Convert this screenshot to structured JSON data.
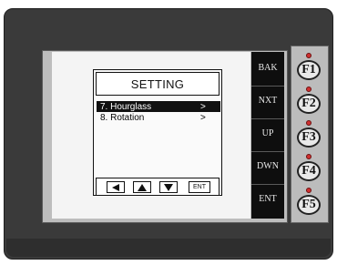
{
  "screen": {
    "title": "SETTING",
    "items": [
      {
        "label": "7. Hourglass",
        "arrow": ">"
      },
      {
        "label": "8. Rotation",
        "arrow": ">"
      }
    ],
    "nav_buttons": [
      "left-arrow",
      "up-arrow",
      "down-arrow",
      "ENT"
    ]
  },
  "softkeys": [
    "BAK",
    "NXT",
    "UP",
    "DWN",
    "ENT"
  ],
  "fkeys": [
    "F1",
    "F2",
    "F3",
    "F4",
    "F5"
  ],
  "colors": {
    "selected_row": "#111111",
    "led": "#d03030",
    "device": "#3a3a3a"
  }
}
